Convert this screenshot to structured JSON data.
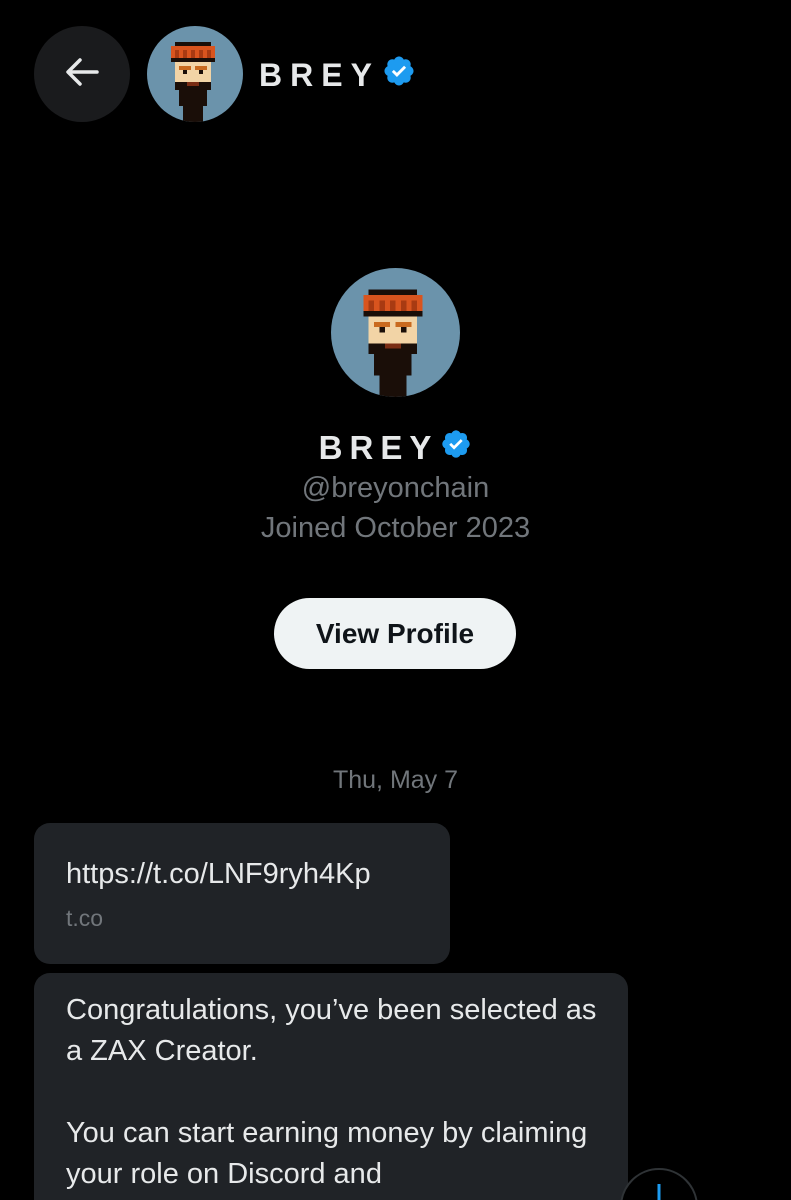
{
  "header": {
    "back_icon": "arrow-left-icon",
    "name": "BREY",
    "verified_icon": "verified-badge-icon"
  },
  "profile": {
    "name": "BREY",
    "handle": "@breyonchain",
    "joined": "Joined October 2023",
    "view_profile_label": "View Profile"
  },
  "conversation": {
    "date_separator": "Thu, May 7",
    "messages": [
      {
        "type": "link",
        "url": "https://t.co/LNF9ryh4Kp",
        "domain": "t.co"
      },
      {
        "type": "text",
        "text": "Congratulations, you’ve been selected as a ZAX Creator.\n\nYou can start earning money by claiming your role on Discord and"
      }
    ],
    "scroll_down_icon": "arrow-down-icon"
  },
  "colors": {
    "background": "#000000",
    "bubble": "#202327",
    "muted_text": "#71767b",
    "verified_blue": "#1d9bf0",
    "avatar_bg": "#6b93ab"
  }
}
